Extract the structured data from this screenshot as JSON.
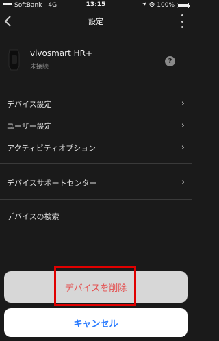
{
  "status_bar": {
    "carrier": "SoftBank",
    "network": "4G",
    "time": "13:15",
    "battery_percent": "100%"
  },
  "nav": {
    "title": "設定",
    "back_icon": "chevron-left-icon",
    "more_icon": "more-vertical-icon"
  },
  "device": {
    "name": "vivosmart HR+",
    "status": "未接続",
    "help_icon": "help-icon",
    "help_glyph": "?"
  },
  "menu": {
    "items": [
      {
        "label": "デバイス設定",
        "chevron": "›"
      },
      {
        "label": "ユーザー設定",
        "chevron": "›"
      },
      {
        "label": "アクティビティオプション",
        "chevron": "›"
      },
      {
        "label": "デバイスサポートセンター",
        "chevron": "›"
      },
      {
        "label": "デバイスの検索",
        "chevron": ""
      }
    ]
  },
  "action_sheet": {
    "delete_label": "デバイスを削除",
    "cancel_label": "キャンセル"
  },
  "colors": {
    "background": "#1a1a1a",
    "delete_text": "#e45050",
    "cancel_text": "#2a7bff",
    "highlight": "#e00000"
  }
}
